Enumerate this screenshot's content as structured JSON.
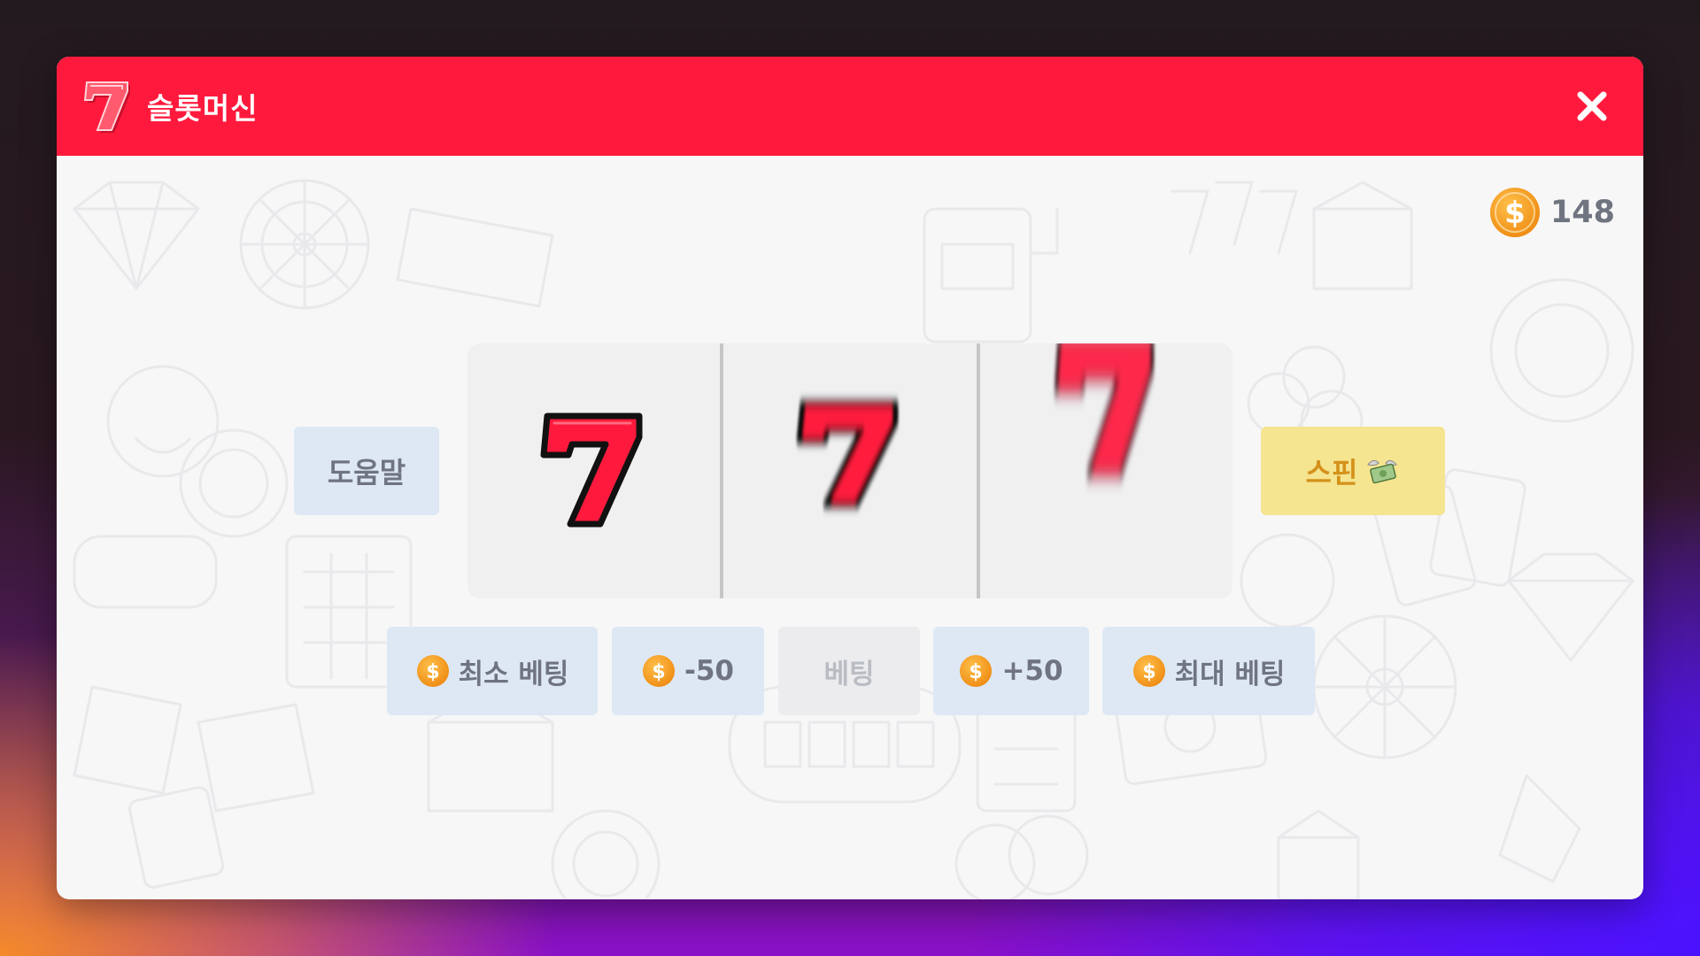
{
  "window": {
    "title": "슬롯머신",
    "logo_icon": "lucky-seven-icon",
    "close_icon": "close-icon"
  },
  "balance": {
    "icon": "coin-icon",
    "value": "148"
  },
  "buttons": {
    "help": "도움말",
    "spin": "스핀",
    "spin_icon": "money-wings-icon"
  },
  "reels": [
    {
      "symbol": "7",
      "state": "stopped"
    },
    {
      "symbol": "7",
      "state": "spinning"
    },
    {
      "symbol": "7",
      "state": "spinning"
    }
  ],
  "bet_controls": {
    "min_bet": "최소 베팅",
    "decrease": "-50",
    "bet_label": "베팅",
    "increase": "+50",
    "max_bet": "최대 베팅"
  },
  "colors": {
    "titlebar": "#ff1a3d",
    "symbol_red": "#ff1a3d",
    "coin": "#f5a025",
    "button_blue": "#dde8f4",
    "button_yellow": "#f5e490",
    "button_disabled": "#ececee"
  }
}
